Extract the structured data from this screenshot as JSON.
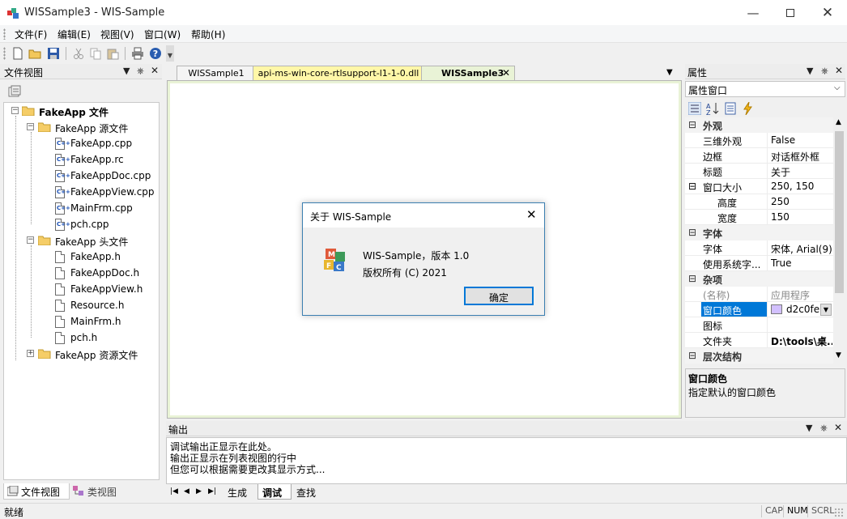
{
  "window": {
    "title": "WISSample3 - WIS-Sample"
  },
  "menu": [
    "文件(F)",
    "编辑(E)",
    "视图(V)",
    "窗口(W)",
    "帮助(H)"
  ],
  "file_view": {
    "title": "文件视图",
    "root": "FakeApp 文件",
    "groups": [
      {
        "name": "FakeApp 源文件",
        "files": [
          "FakeApp.cpp",
          "FakeApp.rc",
          "FakeAppDoc.cpp",
          "FakeAppView.cpp",
          "MainFrm.cpp",
          "pch.cpp"
        ]
      },
      {
        "name": "FakeApp 头文件",
        "files": [
          "FakeApp.h",
          "FakeAppDoc.h",
          "FakeAppView.h",
          "Resource.h",
          "MainFrm.h",
          "pch.h"
        ]
      },
      {
        "name": "FakeApp 资源文件",
        "files": []
      }
    ],
    "bottom_tabs": [
      "文件视图",
      "类视图"
    ]
  },
  "doc_tabs": [
    "WISSample1",
    "api-ms-win-core-rtlsupport-l1-1-0.dll",
    "WISSample3"
  ],
  "properties": {
    "title": "属性",
    "combo": "属性窗口",
    "categories": [
      {
        "name": "外观",
        "rows": [
          {
            "name": "三维外观",
            "value": "False"
          },
          {
            "name": "边框",
            "value": "对话框外框"
          },
          {
            "name": "标题",
            "value": "关于"
          },
          {
            "name": "窗口大小",
            "value": "250, 150"
          },
          {
            "name": "高度",
            "value": "250"
          },
          {
            "name": "宽度",
            "value": "150"
          }
        ]
      },
      {
        "name": "字体",
        "rows": [
          {
            "name": "字体",
            "value": "宋体, Arial(9)"
          },
          {
            "name": "使用系统字...",
            "value": "True"
          }
        ]
      },
      {
        "name": "杂项",
        "rows": [
          {
            "name": "(名称)",
            "value": "应用程序"
          },
          {
            "name": "窗口颜色",
            "value": "d2c0fe"
          },
          {
            "name": "图标",
            "value": ""
          },
          {
            "name": "文件夹",
            "value": "D:\\tools\\桌..."
          }
        ]
      },
      {
        "name": "层次结构",
        "rows": []
      }
    ],
    "swatch_color": "#d2c0fe",
    "desc_title": "窗口颜色",
    "desc_text": "指定默认的窗口颜色"
  },
  "dialog": {
    "title": "关于 WIS-Sample",
    "line1": "WIS-Sample，版本 1.0",
    "line2": "版权所有 (C) 2021",
    "ok": "确定"
  },
  "output": {
    "title": "输出",
    "lines": [
      "调试输出正显示在此处。",
      "输出正显示在列表视图的行中",
      "但您可以根据需要更改其显示方式..."
    ],
    "tabs": [
      "生成",
      "调试",
      "查找"
    ]
  },
  "status": {
    "text": "就绪",
    "indicators": [
      "CAP",
      "NUM",
      "SCRL"
    ]
  }
}
